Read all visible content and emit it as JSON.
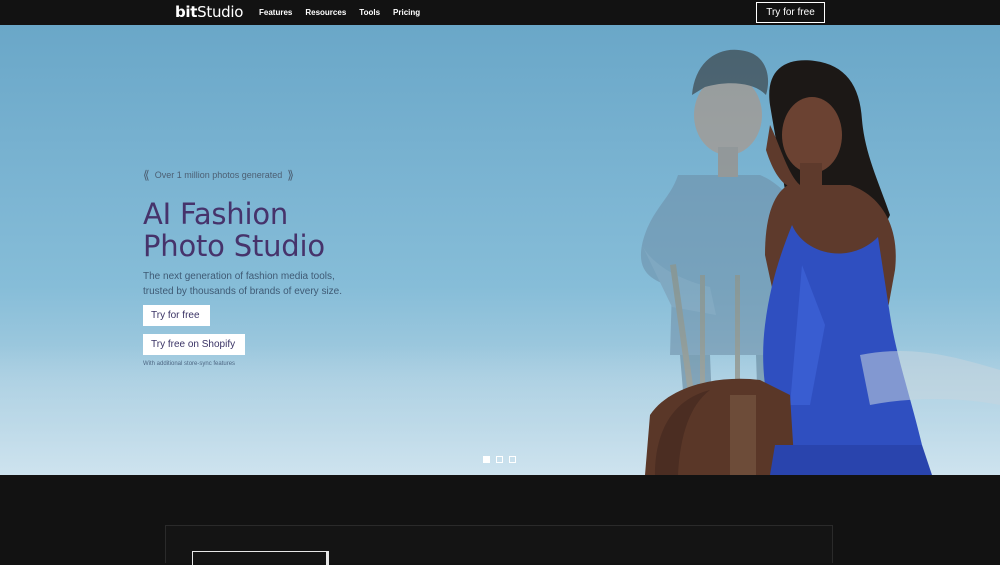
{
  "brand": {
    "logo_bold": "bit",
    "logo_rest": "Studio"
  },
  "nav": {
    "links": [
      "Features",
      "Resources",
      "Tools",
      "Pricing"
    ],
    "cta": "Try for free"
  },
  "hero": {
    "badge": "Over 1 million photos generated",
    "headline_line1": "AI Fashion",
    "headline_line2": "Photo Studio",
    "subtext_line1": "The next generation of fashion media tools,",
    "subtext_line2": "trusted by thousands of brands of every size.",
    "primary_button": "Try for free",
    "secondary_button": "Try free on Shopify",
    "footnote": "With additional store-sync features",
    "carousel": {
      "slide_count": 3,
      "active_index": 0
    }
  },
  "colors": {
    "nav_bg": "#121212",
    "headline": "#46336b",
    "hero_sky": "#7bb4d2",
    "dress": "#2f4fc0"
  }
}
